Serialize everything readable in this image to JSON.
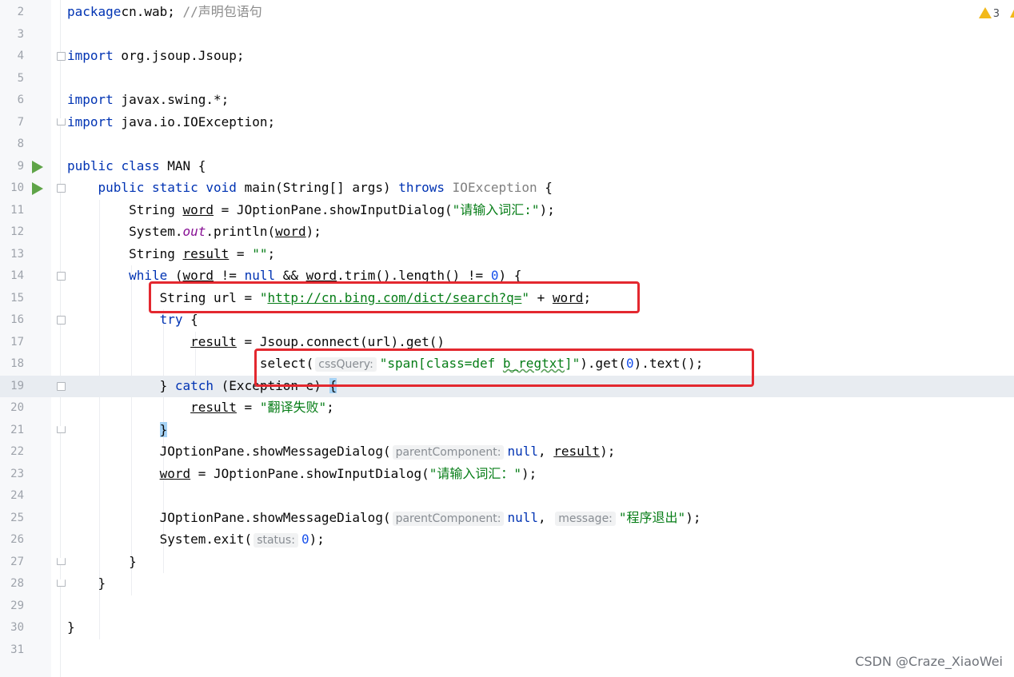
{
  "editor": {
    "warning_count": "3",
    "watermark": "CSDN @Craze_XiaoWei",
    "lines": [
      {
        "n": "2",
        "tokens": [
          [
            "kw",
            "package"
          ],
          [
            "",
            "cn.wab; "
          ],
          [
            "cm",
            "//声明包语句"
          ]
        ]
      },
      {
        "n": "3",
        "tokens": []
      },
      {
        "n": "4",
        "tokens": [
          [
            "kw",
            "import"
          ],
          [
            "",
            " org.jsoup.Jsoup;"
          ]
        ]
      },
      {
        "n": "5",
        "tokens": []
      },
      {
        "n": "6",
        "tokens": [
          [
            "kw",
            "import"
          ],
          [
            "",
            " javax.swing.*;"
          ]
        ]
      },
      {
        "n": "7",
        "tokens": [
          [
            "kw",
            "import"
          ],
          [
            "",
            " java.io.IOException;"
          ]
        ]
      },
      {
        "n": "8",
        "tokens": []
      },
      {
        "n": "9",
        "tokens": [
          [
            "kw",
            "public"
          ],
          [
            "",
            " "
          ],
          [
            "kw",
            "class"
          ],
          [
            "",
            " MAN {"
          ]
        ]
      },
      {
        "n": "10",
        "tokens": [
          [
            "",
            "    "
          ],
          [
            "kw",
            "public"
          ],
          [
            "",
            " "
          ],
          [
            "kw",
            "static"
          ],
          [
            "",
            " "
          ],
          [
            "kw",
            "void"
          ],
          [
            "",
            " main(String[] args) "
          ],
          [
            "kw",
            "throws"
          ],
          [
            "",
            " "
          ],
          [
            "gray",
            "IOException"
          ],
          [
            "",
            " {"
          ]
        ]
      },
      {
        "n": "11",
        "tokens": [
          [
            "",
            "        String "
          ],
          [
            "ul",
            "word"
          ],
          [
            "",
            " = JOptionPane.showInputDialog("
          ],
          [
            "str",
            "\"请输入词汇:\""
          ],
          [
            "",
            ");"
          ]
        ]
      },
      {
        "n": "12",
        "tokens": [
          [
            "",
            "        System."
          ],
          [
            "ital",
            "out"
          ],
          [
            "",
            ".println("
          ],
          [
            "ul",
            "word"
          ],
          [
            "",
            ");"
          ]
        ]
      },
      {
        "n": "13",
        "tokens": [
          [
            "",
            "        String "
          ],
          [
            "ul",
            "result"
          ],
          [
            "",
            " = "
          ],
          [
            "str",
            "\"\""
          ],
          [
            "",
            ";"
          ]
        ]
      },
      {
        "n": "14",
        "tokens": [
          [
            "",
            "        "
          ],
          [
            "kw",
            "while"
          ],
          [
            "",
            " ("
          ],
          [
            "ul",
            "word"
          ],
          [
            "",
            " != "
          ],
          [
            "kw",
            "null"
          ],
          [
            "",
            " && "
          ],
          [
            "ul",
            "word"
          ],
          [
            "",
            ".trim().length() != "
          ],
          [
            "num",
            "0"
          ],
          [
            "",
            ") {"
          ]
        ]
      },
      {
        "n": "15",
        "tokens": [
          [
            "",
            "            String url = "
          ],
          [
            "str",
            "\""
          ],
          [
            "link",
            "http://cn.bing.com/dict/search?q="
          ],
          [
            "str",
            "\""
          ],
          [
            "",
            " + "
          ],
          [
            "ul",
            "word"
          ],
          [
            "",
            ";"
          ]
        ]
      },
      {
        "n": "16",
        "tokens": [
          [
            "",
            "            "
          ],
          [
            "kw",
            "try"
          ],
          [
            "",
            " {"
          ]
        ]
      },
      {
        "n": "17",
        "tokens": [
          [
            "",
            "                "
          ],
          [
            "ul",
            "result"
          ],
          [
            "",
            " = Jsoup.connect(url).get()"
          ]
        ]
      },
      {
        "n": "18",
        "tokens": [
          [
            "",
            "                        .select("
          ],
          [
            "hint",
            "cssQuery:"
          ],
          [
            "str",
            "\"span[class=def "
          ],
          [
            "str wavy",
            "b_regtxt"
          ],
          [
            "str",
            "]\""
          ],
          [
            "",
            ").get("
          ],
          [
            "num",
            "0"
          ],
          [
            "",
            ").text();"
          ]
        ]
      },
      {
        "n": "19",
        "tokens": [
          [
            "",
            "            } "
          ],
          [
            "kw",
            "catch"
          ],
          [
            "",
            " (Exception e) "
          ],
          [
            "brace-hl",
            "{"
          ]
        ]
      },
      {
        "n": "20",
        "tokens": [
          [
            "",
            "                "
          ],
          [
            "ul",
            "result"
          ],
          [
            "",
            " = "
          ],
          [
            "str",
            "\"翻译失败\""
          ],
          [
            "",
            ";"
          ]
        ]
      },
      {
        "n": "21",
        "tokens": [
          [
            "",
            "            "
          ],
          [
            "brace-hl",
            "}"
          ]
        ]
      },
      {
        "n": "22",
        "tokens": [
          [
            "",
            "            JOptionPane.showMessageDialog("
          ],
          [
            "hint",
            "parentComponent:"
          ],
          [
            "kw",
            "null"
          ],
          [
            "",
            ", "
          ],
          [
            "ul",
            "result"
          ],
          [
            "",
            ");"
          ]
        ]
      },
      {
        "n": "23",
        "tokens": [
          [
            "",
            "            "
          ],
          [
            "ul",
            "word"
          ],
          [
            "",
            " = JOptionPane.showInputDialog("
          ],
          [
            "str",
            "\"请输入词汇：\""
          ],
          [
            "",
            ");"
          ]
        ]
      },
      {
        "n": "24",
        "tokens": []
      },
      {
        "n": "25",
        "tokens": [
          [
            "",
            "            JOptionPane.showMessageDialog("
          ],
          [
            "hint",
            "parentComponent:"
          ],
          [
            "kw",
            "null"
          ],
          [
            "",
            ", "
          ],
          [
            "hint",
            "message:"
          ],
          [
            "str",
            "\"程序退出\""
          ],
          [
            "",
            ");"
          ]
        ]
      },
      {
        "n": "26",
        "tokens": [
          [
            "",
            "            System.exit("
          ],
          [
            "hint",
            "status:"
          ],
          [
            "num",
            "0"
          ],
          [
            "",
            ");"
          ]
        ]
      },
      {
        "n": "27",
        "tokens": [
          [
            "",
            "        }"
          ]
        ]
      },
      {
        "n": "28",
        "tokens": [
          [
            "",
            "    }"
          ]
        ]
      },
      {
        "n": "29",
        "tokens": []
      },
      {
        "n": "30",
        "tokens": [
          [
            "",
            "}"
          ]
        ]
      },
      {
        "n": "31",
        "tokens": []
      }
    ]
  }
}
